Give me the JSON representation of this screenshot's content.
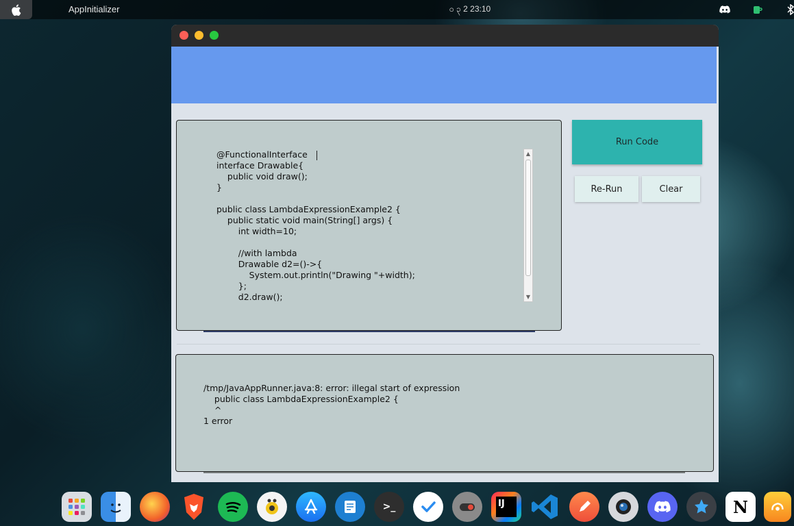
{
  "menubar": {
    "app_name": "AppInitializer",
    "clock": "ဝ ၃ 2 23:10"
  },
  "editor": {
    "code": "@FunctionalInterface\ninterface Drawable{\n    public void draw();\n}\n\npublic class LambdaExpressionExample2 {\n    public static void main(String[] args) {\n        int width=10;\n\n        //with lambda\n        Drawable d2=()->{\n            System.out.println(\"Drawing \"+width);\n        };\n        d2.draw();"
  },
  "buttons": {
    "run": "Run Code",
    "rerun": "Re-Run",
    "clear": "Clear"
  },
  "output": {
    "text": "/tmp/JavaAppRunner.java:8: error: illegal start of expression\n    public class LambdaExpressionExample2 {\n    ^\n1 error"
  },
  "dock": {
    "items": [
      {
        "name": "launchpad-icon",
        "color": "#d9dde2"
      },
      {
        "name": "finder-icon",
        "color": "#3a8ee6"
      },
      {
        "name": "firefox-icon",
        "color": "#f2622a"
      },
      {
        "name": "brave-icon",
        "color": "#fb542b"
      },
      {
        "name": "spotify-icon",
        "color": "#1db954"
      },
      {
        "name": "audio-player-icon",
        "color": "#f0c419"
      },
      {
        "name": "app-store-icon",
        "color": "#1a8cf0"
      },
      {
        "name": "document-viewer-icon",
        "color": "#1e7fd1"
      },
      {
        "name": "terminal-icon",
        "color": "#2e2e2e"
      },
      {
        "name": "tasks-icon",
        "color": "#ffffff"
      },
      {
        "name": "toggle-app-icon",
        "color": "#5a5a5a"
      },
      {
        "name": "intellij-idea-icon",
        "color": "#1e1e1e"
      },
      {
        "name": "vscode-icon",
        "color": "#1a86d6"
      },
      {
        "name": "drawing-app-icon",
        "color": "#f36a3d"
      },
      {
        "name": "camera-app-icon",
        "color": "#c9ccd1"
      },
      {
        "name": "discord-dock-icon",
        "color": "#5865f2"
      },
      {
        "name": "star-app-icon",
        "color": "#3b3f45"
      },
      {
        "name": "notion-icon",
        "color": "#ffffff"
      },
      {
        "name": "weather-app-icon",
        "color": "#f7a021"
      }
    ]
  }
}
